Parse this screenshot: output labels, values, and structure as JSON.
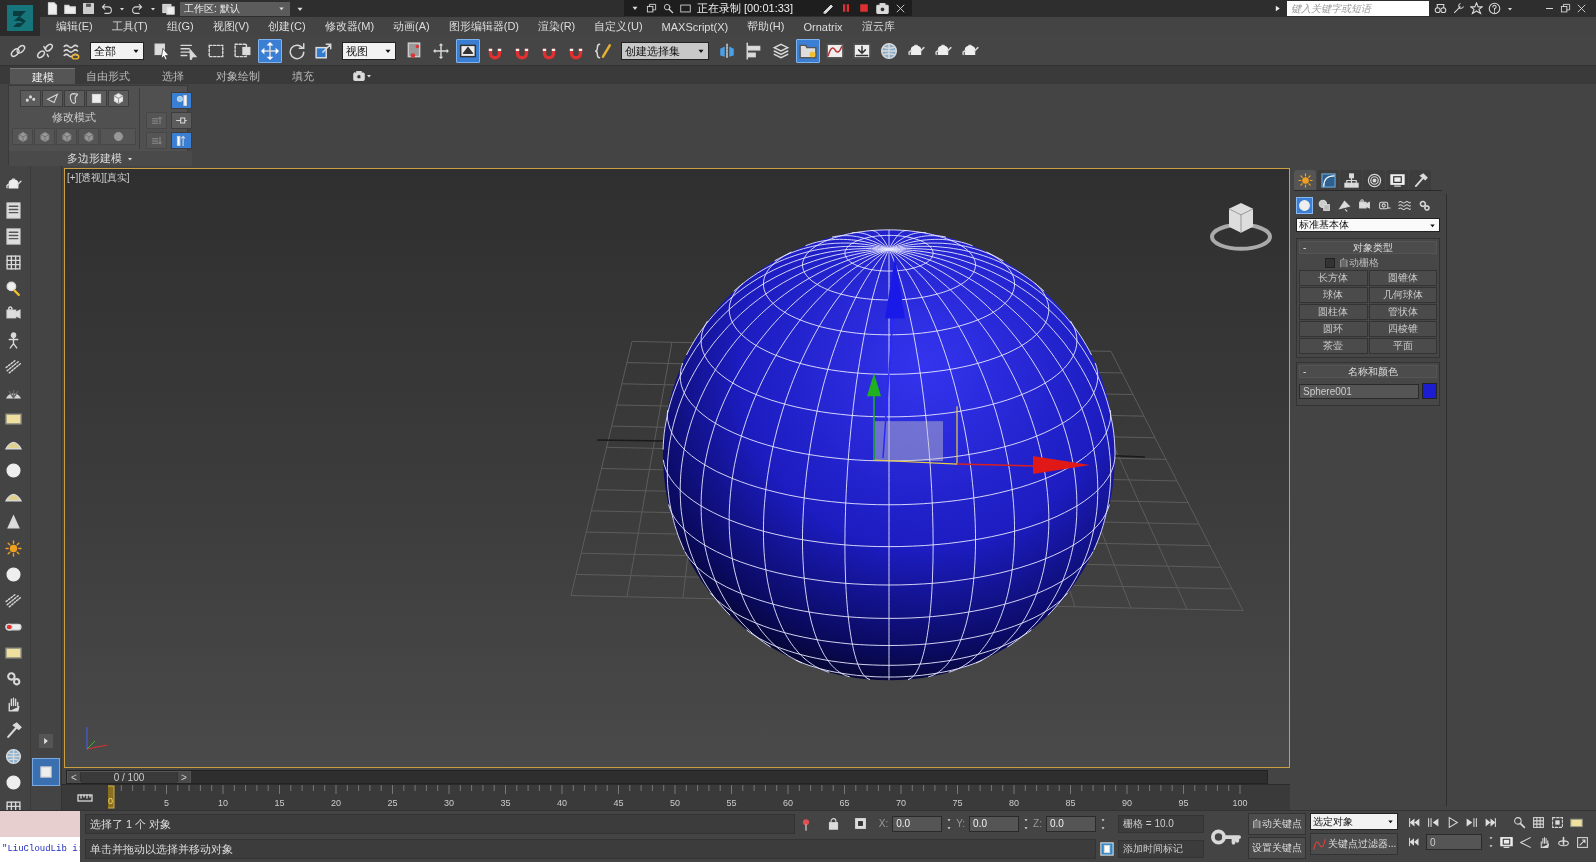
{
  "title_bar": {
    "workspace": "工作区: 默认",
    "search": {
      "placeholder": "键入关键字或短语"
    }
  },
  "recorder": {
    "status": "正在录制 [00:01:33]"
  },
  "menu": [
    "编辑(E)",
    "工具(T)",
    "组(G)",
    "视图(V)",
    "创建(C)",
    "修改器(M)",
    "动画(A)",
    "图形编辑器(D)",
    "渲染(R)",
    "自定义(U)",
    "MAXScript(X)",
    "帮助(H)",
    "Ornatrix",
    "渲云库"
  ],
  "toolbar": [
    {
      "kind": "link",
      "selected": false
    },
    {
      "kind": "unlink",
      "selected": false
    },
    {
      "kind": "bind",
      "selected": false
    },
    {
      "kind": "dropdown",
      "value": "全部"
    },
    {
      "kind": "select",
      "selected": false
    },
    {
      "kind": "select-by-name",
      "selected": false
    },
    {
      "kind": "region",
      "selected": false
    },
    {
      "kind": "window-crossing",
      "selected": false
    },
    {
      "kind": "move",
      "selected": true
    },
    {
      "kind": "rotate",
      "selected": false
    },
    {
      "kind": "scale",
      "selected": false
    },
    {
      "kind": "dropdown",
      "value": "视图"
    },
    {
      "kind": "pivot",
      "selected": false
    },
    {
      "kind": "manipulate",
      "selected": false
    },
    {
      "kind": "keyboard",
      "selected": true
    },
    {
      "kind": "snap",
      "selected": false
    },
    {
      "kind": "angle-snap",
      "selected": false
    },
    {
      "kind": "percent-snap",
      "selected": false
    },
    {
      "kind": "spinner-snap",
      "selected": false
    },
    {
      "kind": "named-sets",
      "selected": false
    },
    {
      "kind": "dropdown",
      "value": "创建选择集"
    },
    {
      "kind": "mirror",
      "selected": false
    },
    {
      "kind": "align",
      "selected": false
    },
    {
      "kind": "layers",
      "selected": false
    },
    {
      "kind": "scene-explorer",
      "selected": true
    },
    {
      "kind": "curve-editor",
      "selected": false
    },
    {
      "kind": "schematic",
      "selected": false
    },
    {
      "kind": "material-editor",
      "selected": false
    },
    {
      "kind": "render-setup",
      "selected": false
    },
    {
      "kind": "rendered-frame",
      "selected": false
    },
    {
      "kind": "render",
      "selected": false
    }
  ],
  "ribbon": {
    "tabs": [
      {
        "label": "建模",
        "selected": true
      },
      {
        "label": "自由形式",
        "selected": false
      },
      {
        "label": "选择",
        "selected": false
      },
      {
        "label": "对象绘制",
        "selected": false
      },
      {
        "label": "填充",
        "selected": false
      }
    ],
    "panel": {
      "mode_label": "修改模式",
      "title": "多边形建模",
      "subobjects": [
        {
          "kind": "vertex",
          "selected": false
        },
        {
          "kind": "edge",
          "selected": false
        },
        {
          "kind": "border",
          "selected": false
        },
        {
          "kind": "polygon",
          "selected": false
        },
        {
          "kind": "element",
          "selected": false
        }
      ],
      "side_tools": [
        {
          "kind": "pin-stack",
          "selected": true
        },
        {
          "kind": "show-result",
          "selected": false
        },
        {
          "kind": "make-unique",
          "selected": true
        }
      ]
    }
  },
  "viewport": {
    "label": "[+][透视][真实]"
  },
  "command_panel": {
    "tabs": [
      {
        "kind": "create",
        "selected": true
      },
      {
        "kind": "modify",
        "selected": false
      },
      {
        "kind": "hierarchy",
        "selected": false
      },
      {
        "kind": "motion",
        "selected": false
      },
      {
        "kind": "display",
        "selected": false
      },
      {
        "kind": "utilities",
        "selected": false
      }
    ],
    "categories": [
      {
        "kind": "geometry",
        "selected": true
      },
      {
        "kind": "shapes",
        "selected": false
      },
      {
        "kind": "lights",
        "selected": false
      },
      {
        "kind": "cameras",
        "selected": false
      },
      {
        "kind": "helpers",
        "selected": false
      },
      {
        "kind": "space-warps",
        "selected": false
      },
      {
        "kind": "systems",
        "selected": false
      }
    ],
    "type_list": "标准基本体",
    "object_type": {
      "collapse": "-",
      "title": "对象类型",
      "autogrid": {
        "label": "自动栅格",
        "checked": false
      },
      "buttons": [
        "长方体",
        "圆锥体",
        "球体",
        "几何球体",
        "圆柱体",
        "管状体",
        "圆环",
        "四棱锥",
        "茶壶",
        "平面"
      ]
    },
    "name_color": {
      "collapse": "-",
      "title": "名称和颜色",
      "name": "Sphere001",
      "color": "#1c1cd0"
    }
  },
  "time_slider": {
    "label": "0 / 100",
    "prev": "<",
    "next": ">",
    "level": 0
  },
  "ruler": {
    "current": "0",
    "labels": [
      "5",
      "10",
      "15",
      "20",
      "25",
      "30",
      "35",
      "40",
      "45",
      "50",
      "55",
      "60",
      "65",
      "70",
      "75",
      "80",
      "85",
      "90",
      "95",
      "100"
    ]
  },
  "listener": {
    "text": "\"LiuCloudLib i:"
  },
  "status": {
    "selection": "选择了 1 个 对象",
    "prompt": "单击并拖动以选择并移动对象"
  },
  "coords": [
    {
      "axis": "X:",
      "value": "0.0"
    },
    {
      "axis": "Y:",
      "value": "0.0"
    },
    {
      "axis": "Z:",
      "value": "0.0"
    }
  ],
  "grid": "栅格 = 10.0",
  "time_tag": "添加时间标记",
  "keys": {
    "auto_key": "自动关键点",
    "set_key": "设置关键点",
    "selection_set": "选定对象",
    "filters": "关键点过滤器...",
    "frame": "0"
  }
}
